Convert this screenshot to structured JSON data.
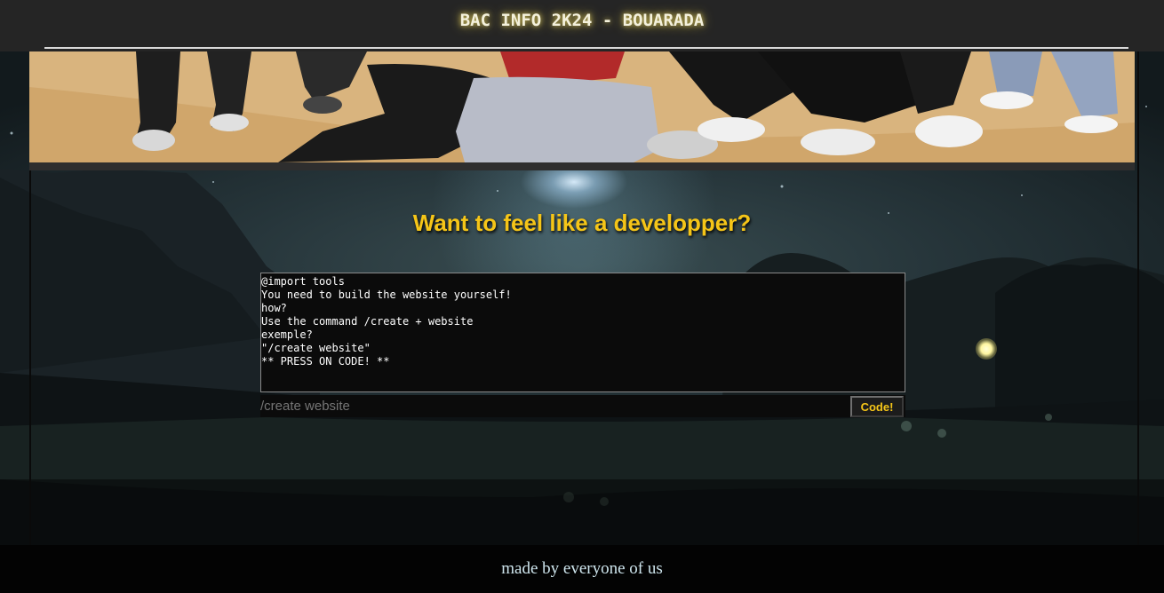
{
  "header": {
    "title": "BAC INFO 2K24 - BOUARADA"
  },
  "banner": {
    "image_description": "group-photo-banner"
  },
  "main": {
    "heading": "Want to feel like a developper?",
    "console": {
      "lines": [
        "@import tools",
        "You need to build the website yourself!",
        "how?",
        "Use the command /create + website",
        "exemple?",
        "\"/create website\"",
        "** PRESS ON CODE! **"
      ]
    },
    "command_input": {
      "placeholder": "/create website"
    },
    "code_button_label": "Code!"
  },
  "footer": {
    "text": "made by everyone of us"
  },
  "colors": {
    "accent": "#f5c518",
    "header_bg": "#252525",
    "console_bg": "#0b0b0b",
    "input_text": "#2e9f2e",
    "footer_bg": "#030303"
  }
}
